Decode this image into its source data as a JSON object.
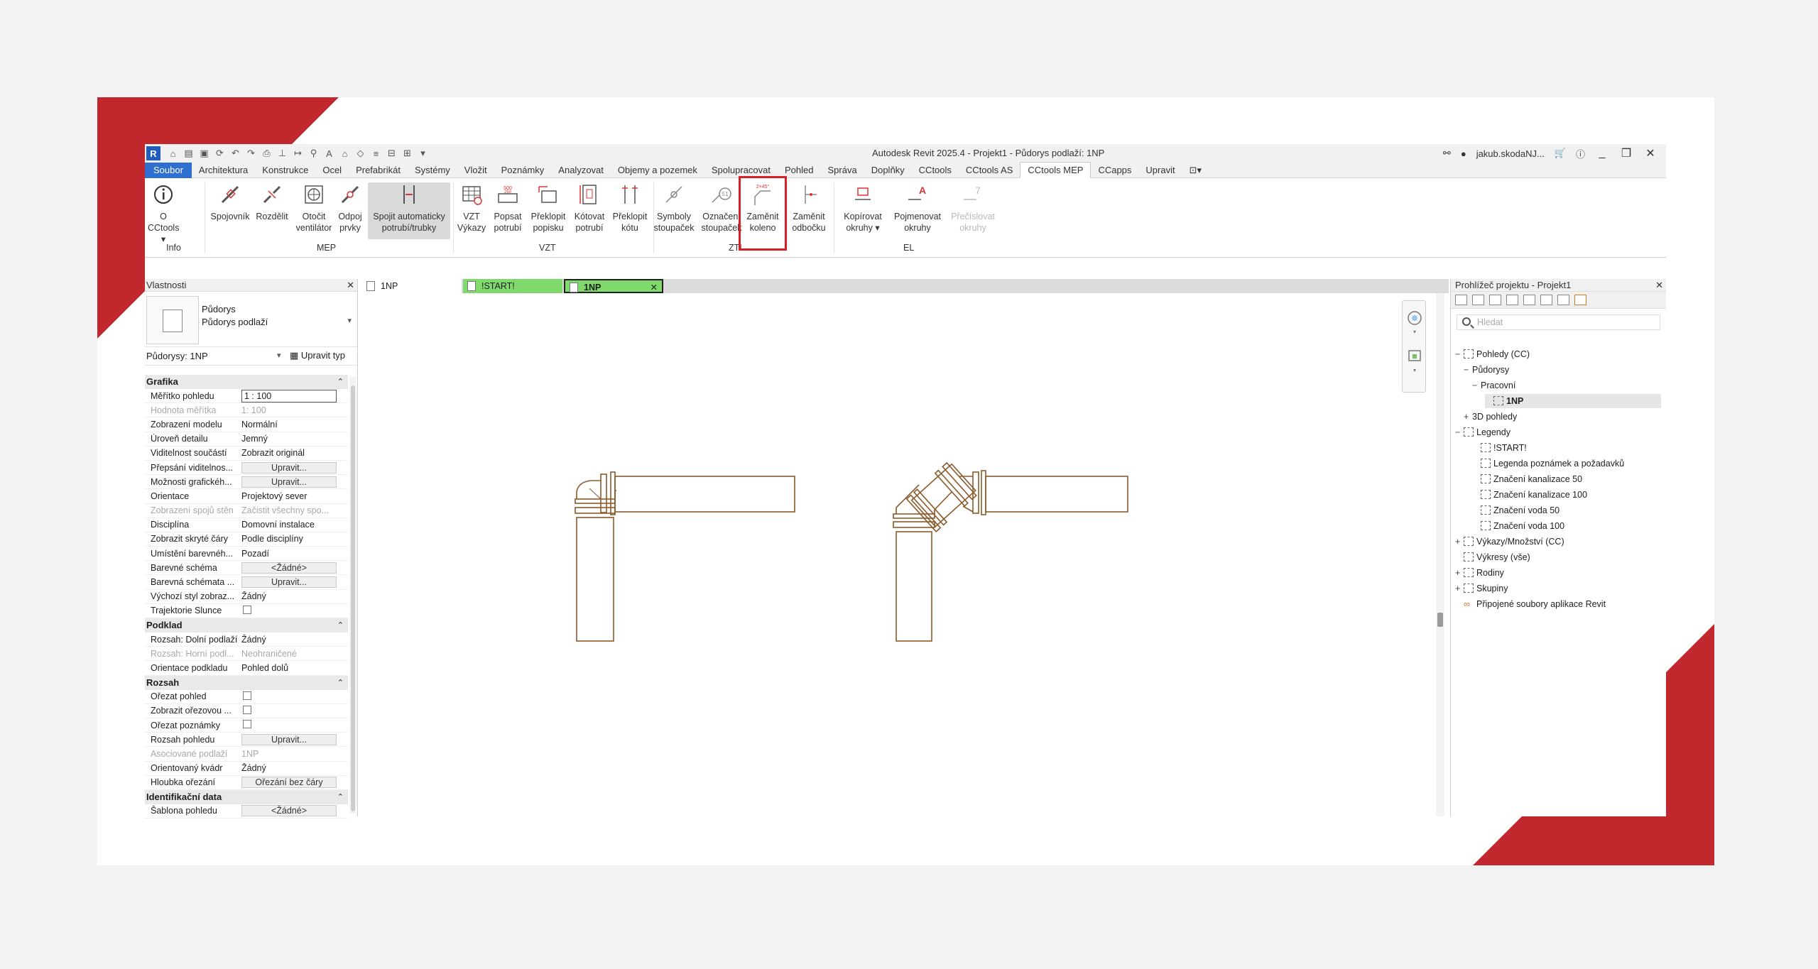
{
  "window": {
    "title": "Autodesk Revit 2025.4 - Projekt1 - Půdorys podlaží: 1NP",
    "user": "jakub.skodaNJ...",
    "logo": "R"
  },
  "tabs": [
    "Soubor",
    "Architektura",
    "Konstrukce",
    "Ocel",
    "Prefabrikát",
    "Systémy",
    "Vložit",
    "Poznámky",
    "Analyzovat",
    "Objemy a pozemek",
    "Spolupracovat",
    "Pohled",
    "Správa",
    "Doplňky",
    "CCtools",
    "CCtools AS",
    "CCtools MEP",
    "CCapps",
    "Upravit"
  ],
  "active_tab": "CCtools MEP",
  "ribbon": {
    "buttons": [
      {
        "l1": "O CCtools",
        "l2": "▾"
      },
      {
        "l1": "Spojovník",
        "l2": ""
      },
      {
        "l1": "Rozdělit",
        "l2": ""
      },
      {
        "l1": "Otočit",
        "l2": "ventilátor"
      },
      {
        "l1": "Odpoj",
        "l2": "prvky"
      },
      {
        "l1": "Spojit automaticky",
        "l2": "potrubí/trubky"
      },
      {
        "l1": "VZT",
        "l2": "Výkazy"
      },
      {
        "l1": "Popsat",
        "l2": "potrubí"
      },
      {
        "l1": "Překlopit",
        "l2": "popisku"
      },
      {
        "l1": "Kótovat",
        "l2": "potrubí"
      },
      {
        "l1": "Překlopit",
        "l2": "kótu"
      },
      {
        "l1": "Symboly",
        "l2": "stoupaček"
      },
      {
        "l1": "Označení",
        "l2": "stoupaček"
      },
      {
        "l1": "Zaměnit",
        "l2": "koleno"
      },
      {
        "l1": "Zaměnit",
        "l2": "odbočku"
      },
      {
        "l1": "Kopírovat",
        "l2": "okruhy ▾"
      },
      {
        "l1": "Pojmenovat",
        "l2": "okruhy"
      },
      {
        "l1": "Přečíslovat",
        "l2": "okruhy"
      }
    ],
    "panels": [
      "Info",
      "MEP",
      "VZT",
      "ZTI",
      "EL"
    ],
    "icon_labels": {
      "angle": "2×45°",
      "tag": "51",
      "vzt_a": "500",
      "vzt_b": "250"
    }
  },
  "properties": {
    "header": "Vlastnosti",
    "type_line1": "Půdorys",
    "type_line2": "Půdorys podlaží",
    "filter": "Půdorysy: 1NP",
    "edit_type": "Upravit typ",
    "sections": {
      "grafika": "Grafika",
      "podklad": "Podklad",
      "rozsah": "Rozsah",
      "ident": "Identifikační data"
    },
    "rows": [
      {
        "k": "Měřítko pohledu",
        "v": "1 : 100"
      },
      {
        "k": "Hodnota měřítka",
        "v": "1:  100"
      },
      {
        "k": "Zobrazení modelu",
        "v": "Normální"
      },
      {
        "k": "Úroveň detailu",
        "v": "Jemný"
      },
      {
        "k": "Viditelnost součástí",
        "v": "Zobrazit originál"
      },
      {
        "k": "Přepsání viditelnos...",
        "v": "Upravit..."
      },
      {
        "k": "Možnosti grafickéh...",
        "v": "Upravit..."
      },
      {
        "k": "Orientace",
        "v": "Projektový sever"
      },
      {
        "k": "Zobrazení spojů stěn",
        "v": "Začistit všechny spo..."
      },
      {
        "k": "Disciplína",
        "v": "Domovní instalace"
      },
      {
        "k": "Zobrazit skryté čáry",
        "v": "Podle disciplíny"
      },
      {
        "k": "Umístění barevnéh...",
        "v": "Pozadí"
      },
      {
        "k": "Barevné schéma",
        "v": "<Žádné>"
      },
      {
        "k": "Barevná schémata ...",
        "v": "Upravit..."
      },
      {
        "k": "Výchozí styl zobraz...",
        "v": "Žádný"
      },
      {
        "k": "Trajektorie Slunce",
        "v": ""
      },
      {
        "k": "Rozsah: Dolní podlaží",
        "v": "Žádný"
      },
      {
        "k": "Rozsah: Horní podl...",
        "v": "Neohraničené"
      },
      {
        "k": "Orientace podkladu",
        "v": "Pohled dolů"
      },
      {
        "k": "Ořezat pohled",
        "v": ""
      },
      {
        "k": "Zobrazit ořezovou ...",
        "v": ""
      },
      {
        "k": "Ořezat poznámky",
        "v": ""
      },
      {
        "k": "Rozsah pohledu",
        "v": "Upravit..."
      },
      {
        "k": "Asociované podlaží",
        "v": "1NP"
      },
      {
        "k": "Orientovaný kvádr",
        "v": "Žádný"
      },
      {
        "k": "Hloubka ořezání",
        "v": "Ořezání bez čáry"
      },
      {
        "k": "Šablona pohledu",
        "v": "<Žádné>"
      }
    ]
  },
  "view_tabs": [
    "1NP",
    "!START!",
    "1NP"
  ],
  "browser": {
    "header": "Prohlížeč projektu - Projekt1",
    "search_placeholder": "Hledat",
    "items": [
      {
        "t": "−",
        "label": "Pohledy (CC)"
      },
      {
        "t": "−",
        "label": "Půdorysy"
      },
      {
        "t": "−",
        "label": "Pracovní"
      },
      {
        "t": "",
        "label": "1NP"
      },
      {
        "t": "+",
        "label": "3D pohledy"
      },
      {
        "t": "−",
        "label": "Legendy"
      },
      {
        "t": "",
        "label": "!START!"
      },
      {
        "t": "",
        "label": "Legenda poznámek a požadavků"
      },
      {
        "t": "",
        "label": "Značení kanalizace 50"
      },
      {
        "t": "",
        "label": "Značení kanalizace 100"
      },
      {
        "t": "",
        "label": "Značení voda 50"
      },
      {
        "t": "",
        "label": "Značení voda 100"
      },
      {
        "t": "+",
        "label": "Výkazy/Množství (CC)"
      },
      {
        "t": "",
        "label": "Výkresy (vše)"
      },
      {
        "t": "+",
        "label": "Rodiny"
      },
      {
        "t": "+",
        "label": "Skupiny"
      },
      {
        "t": "",
        "label": "Připojené soubory aplikace Revit"
      }
    ]
  },
  "colors": {
    "brand_red": "#c0282d",
    "highlight": "#d91f26",
    "pipe": "#8a5a2b",
    "file_tab": "#2f6fd0",
    "start_tab": "#7fd96d"
  }
}
